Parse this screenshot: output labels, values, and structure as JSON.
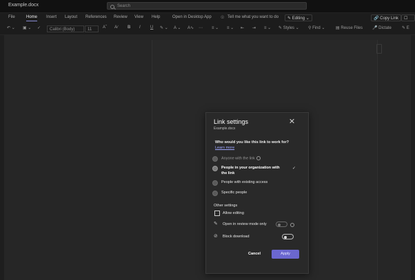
{
  "window": {
    "doc_title": "Example.docx",
    "search_placeholder": "Search"
  },
  "ribbon": {
    "tabs": [
      "File",
      "Home",
      "Insert",
      "Layout",
      "References",
      "Review",
      "View",
      "Help",
      "Open in Desktop App"
    ],
    "tell_me": "Tell me what you want to do",
    "editing": "Editing",
    "copy_link": "Copy Link",
    "font_name": "Calibri (Body)",
    "font_size": "11",
    "styles": "Styles",
    "find": "Find",
    "reuse_files": "Reuse Files",
    "dictate": "Dictate"
  },
  "dialog": {
    "title": "Link settings",
    "subtitle": "Example.docx",
    "question": "Who would you like this link to work for?",
    "learn_more": "Learn more",
    "options": [
      {
        "line1": "Anyone with the link",
        "line2": ""
      },
      {
        "line1": "People in your organization with",
        "line2": "the link"
      },
      {
        "line1": "People with existing access",
        "line2": ""
      },
      {
        "line1": "Specific people",
        "line2": ""
      }
    ],
    "other_settings": "Other settings",
    "allow_editing": "Allow editing",
    "review_mode": "Open in review mode only",
    "block_download": "Block download",
    "cancel": "Cancel",
    "apply": "Apply"
  }
}
